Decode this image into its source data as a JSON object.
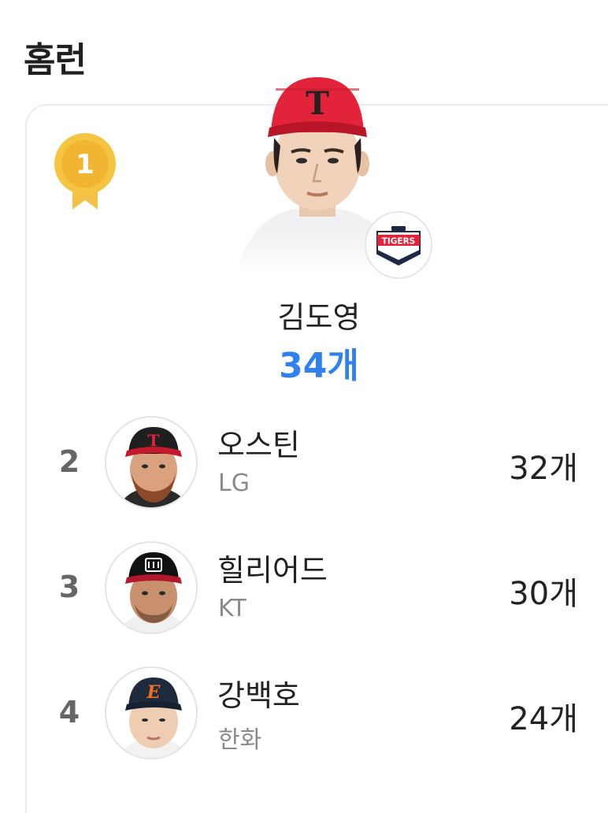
{
  "section": {
    "title": "홈런"
  },
  "leader": {
    "rank": "1",
    "name": "김도영",
    "count": "34개",
    "badge_text": "TIGERS",
    "cap_letter": "T",
    "colors": {
      "cap": "#e2233a",
      "count": "#2f80f0"
    }
  },
  "rankings": [
    {
      "rank": "2",
      "name": "오스틴",
      "team": "LG",
      "count": "32개"
    },
    {
      "rank": "3",
      "name": "힐리어드",
      "team": "KT",
      "count": "30개"
    },
    {
      "rank": "4",
      "name": "강백호",
      "team": "한화",
      "count": "24개"
    }
  ]
}
